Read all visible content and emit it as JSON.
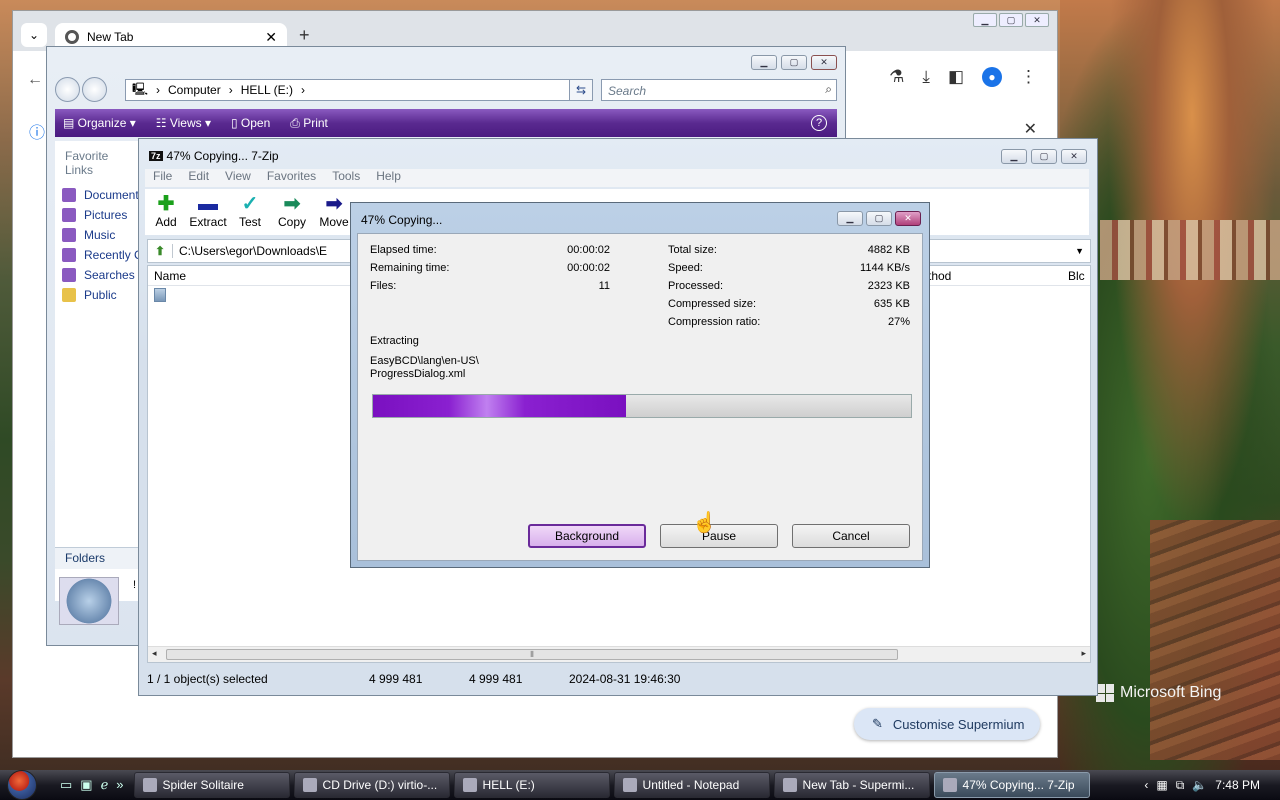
{
  "desktop": {
    "bing_label": "Microsoft Bing"
  },
  "chrome": {
    "tab_title": "New Tab",
    "new_tab_symbol": "+",
    "customise_label": "Customise Supermium"
  },
  "explorer": {
    "breadcrumb": [
      "Computer",
      "HELL (E:)"
    ],
    "search_placeholder": "Search",
    "commands": [
      "Organize",
      "Views",
      "Open",
      "Print"
    ],
    "favorite_links_header": "Favorite Links",
    "favorites": [
      "Documents",
      "Pictures",
      "Music",
      "Recently Changed",
      "Searches",
      "Public"
    ],
    "folders_label": "Folders",
    "detail_mark": "!"
  },
  "zip": {
    "title": "47% Copying... 7-Zip",
    "logo": "7z",
    "menu": [
      "File",
      "Edit",
      "View",
      "Favorites",
      "Tools",
      "Help"
    ],
    "tools": [
      "Add",
      "Extract",
      "Test",
      "Copy",
      "Move"
    ],
    "path": "C:\\Users\\egor\\Downloads\\E",
    "columns": [
      "Name",
      "thod",
      "Blc"
    ],
    "status": {
      "selected": "1 / 1 object(s) selected",
      "size1": "4 999 481",
      "size2": "4 999 481",
      "modified": "2024-08-31 19:46:30"
    }
  },
  "progress": {
    "title": "47% Copying...",
    "left": [
      {
        "label": "Elapsed time:",
        "value": "00:00:02"
      },
      {
        "label": "Remaining time:",
        "value": "00:00:02"
      },
      {
        "label": "Files:",
        "value": "11"
      }
    ],
    "right": [
      {
        "label": "Total size:",
        "value": "4882 KB"
      },
      {
        "label": "Speed:",
        "value": "1144 KB/s"
      },
      {
        "label": "Processed:",
        "value": "2323 KB"
      },
      {
        "label": "Compressed size:",
        "value": "635 KB"
      },
      {
        "label": "Compression ratio:",
        "value": "27%"
      }
    ],
    "operation": "Extracting",
    "file_line1": "EasyBCD\\lang\\en-US\\",
    "file_line2": "ProgressDialog.xml",
    "progress_fraction": 0.47,
    "buttons": {
      "background": "Background",
      "pause": "Pause",
      "cancel": "Cancel"
    }
  },
  "taskbar": {
    "items": [
      "Spider Solitaire",
      "CD Drive (D:) virtio-...",
      "HELL (E:)",
      "Untitled - Notepad",
      "New Tab - Supermi...",
      "47% Copying... 7-Zip"
    ],
    "clock": "7:48 PM"
  }
}
